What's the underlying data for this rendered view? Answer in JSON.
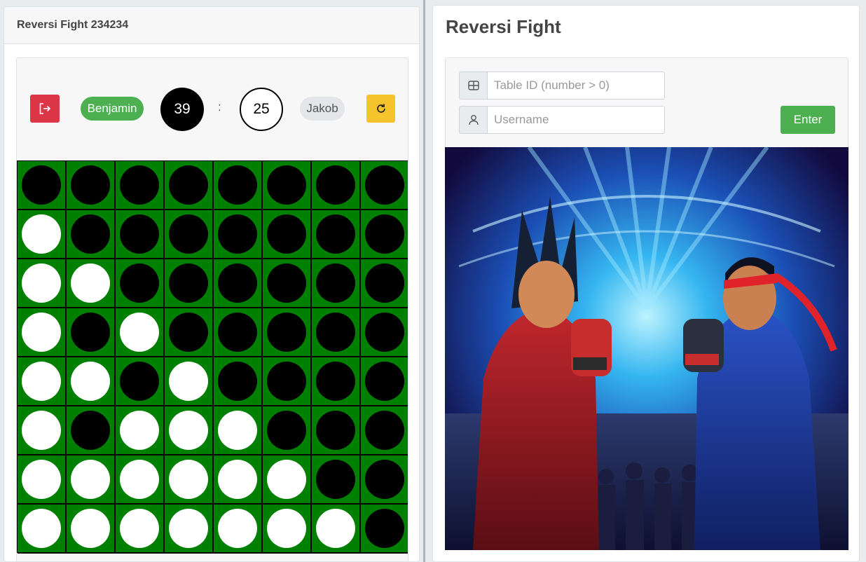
{
  "left": {
    "title": "Reversi Fight 234234",
    "player1": "Benjamin",
    "player2": "Jakob",
    "score_black": "39",
    "score_white": "25",
    "separator": ":"
  },
  "board": [
    "BBBBBBBB",
    "WBBBBBBB",
    "WWBBBBBB",
    "WBWBBBBB",
    "WWBWBBBB",
    "WBWWWBBB",
    "WWWWWWBB",
    "WWWWWWWB"
  ],
  "right": {
    "title": "Reversi Fight",
    "table_placeholder": "Table ID (number > 0)",
    "username_placeholder": "Username",
    "enter_label": "Enter"
  },
  "colors": {
    "board_green": "#008000",
    "exit_red": "#dc3545",
    "reset_yellow": "#f5c32c",
    "active_green": "#4caf50"
  },
  "icons": {
    "exit": "logout-icon",
    "reset": "refresh-icon",
    "table": "grid-icon",
    "user": "person-icon"
  }
}
